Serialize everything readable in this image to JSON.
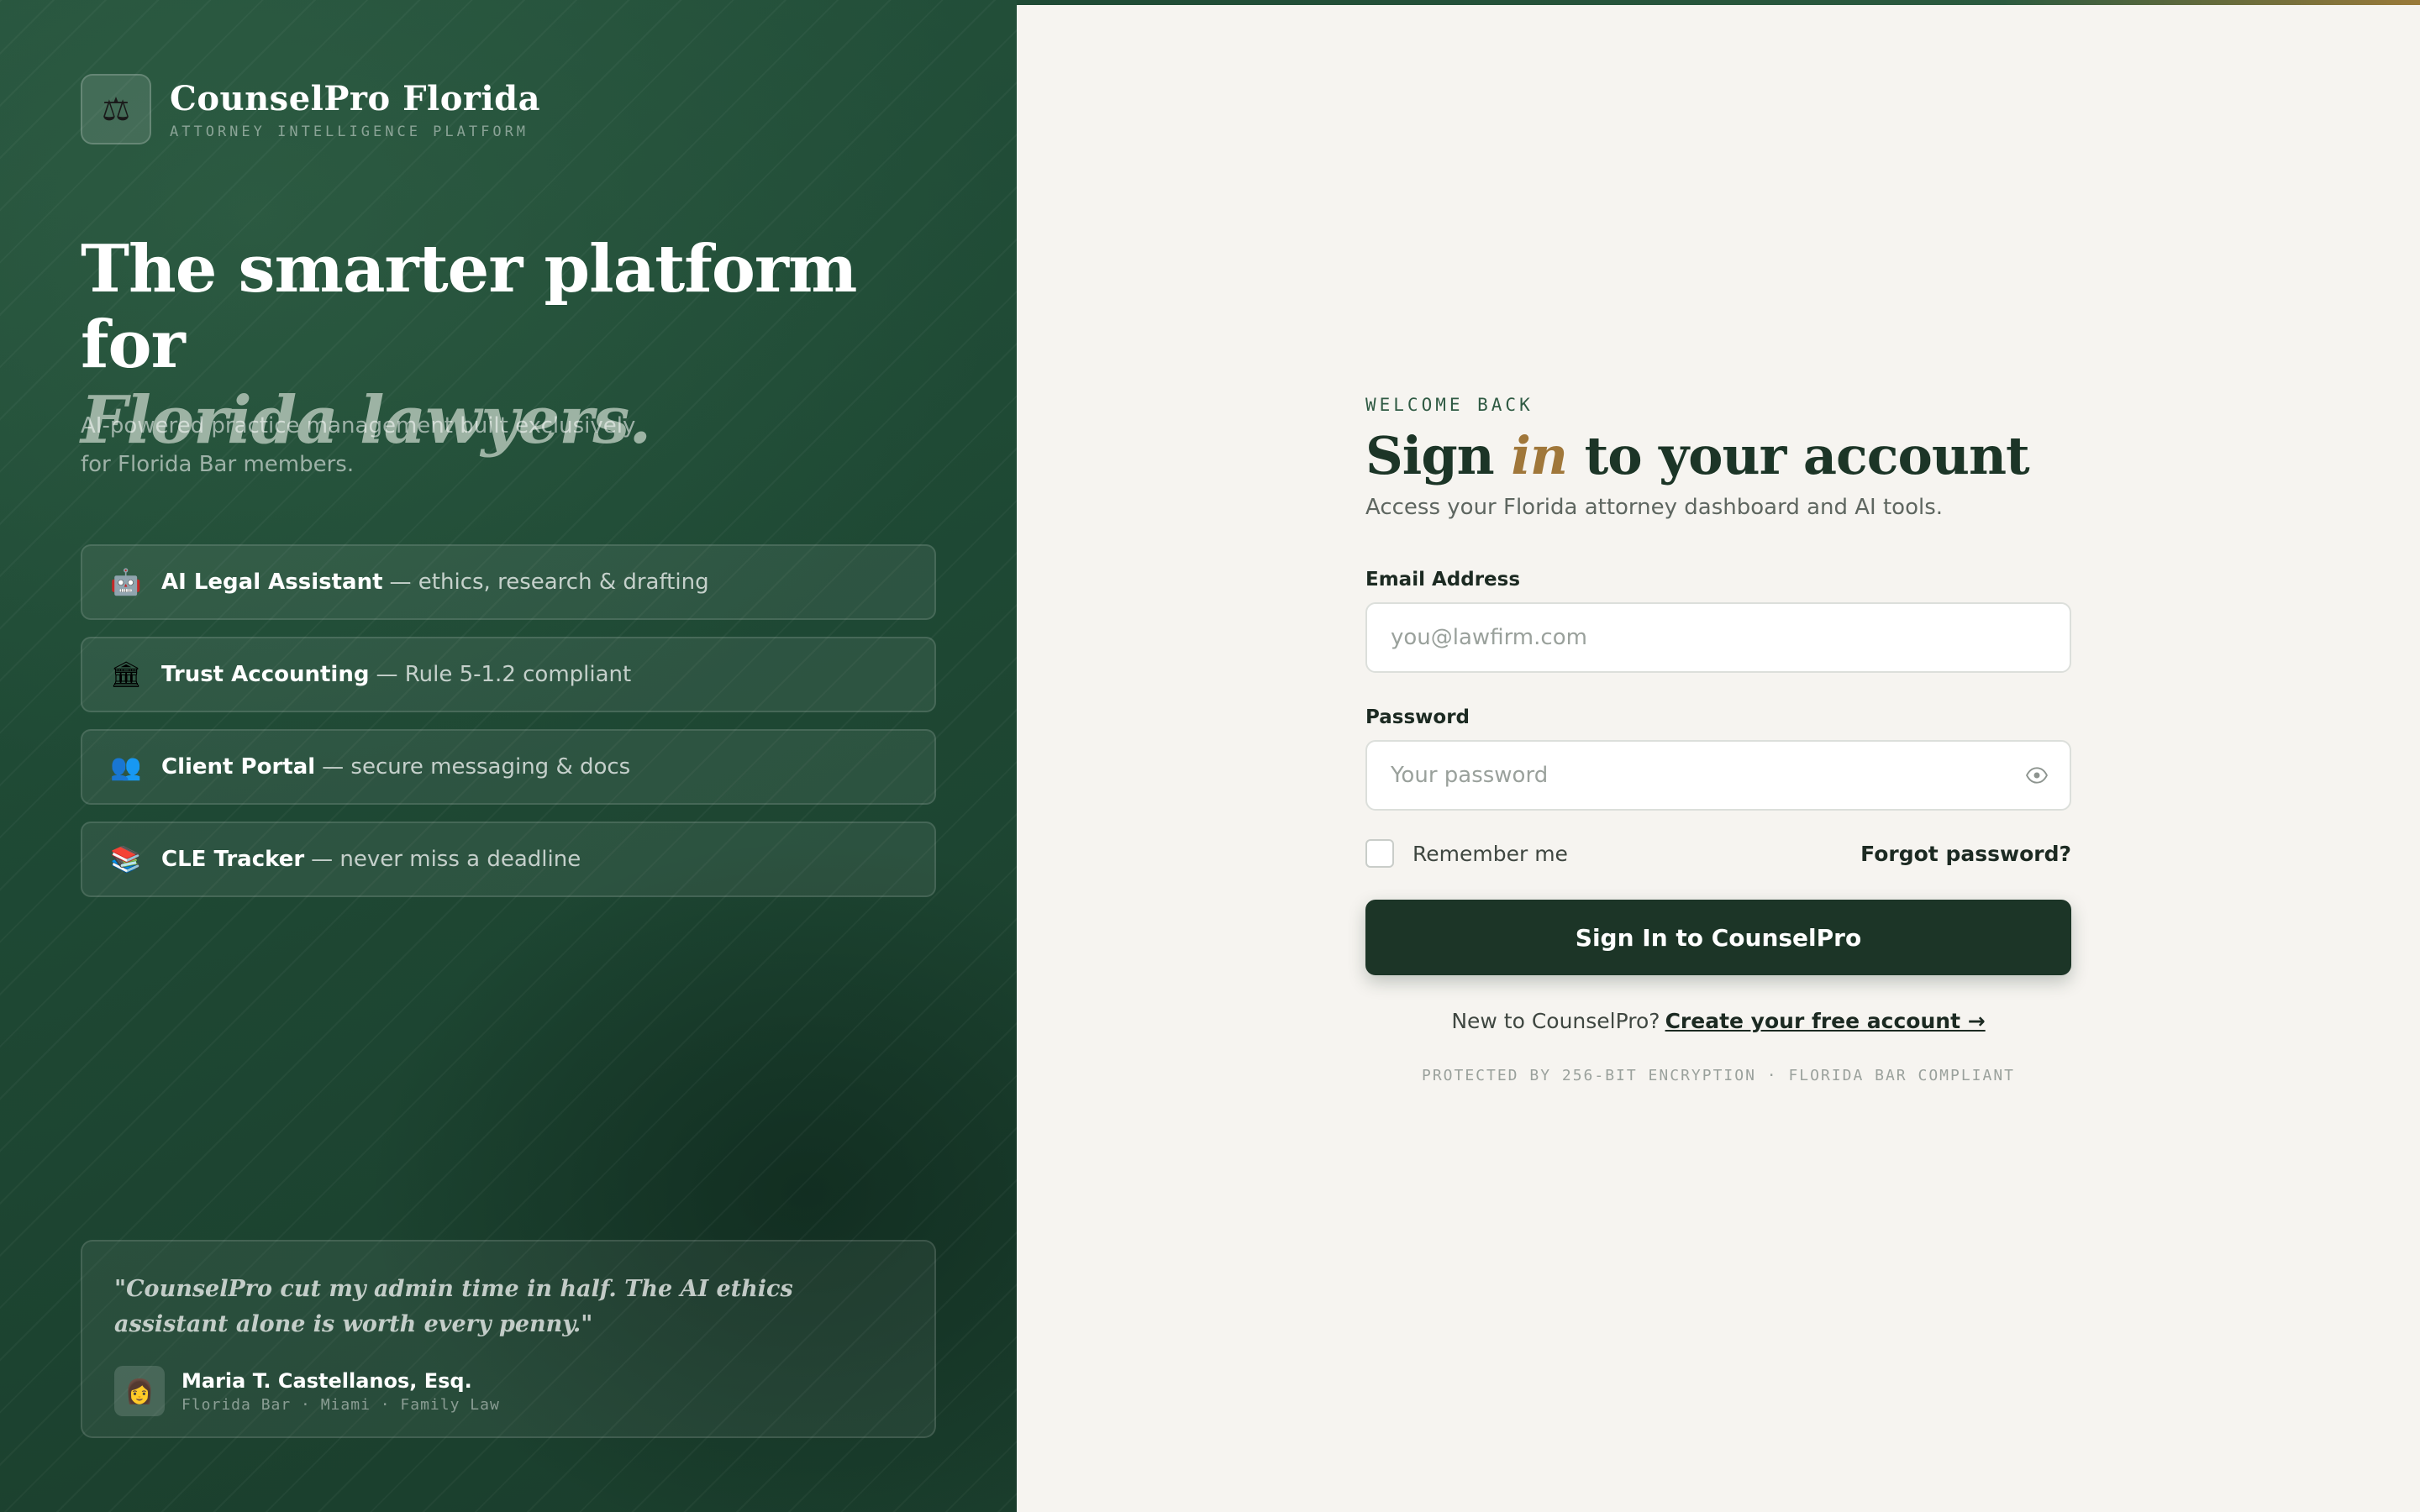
{
  "brand": {
    "icon": "⚖",
    "name": "CounselPro Florida",
    "tagline": "ATTORNEY INTELLIGENCE PLATFORM"
  },
  "hero": {
    "line1": "The smarter platform for",
    "line2": "Florida lawyers.",
    "subhead": "AI-powered practice management built exclusively for Florida Bar members."
  },
  "features": [
    {
      "icon": "🤖",
      "title": "AI Legal Assistant",
      "desc": "— ethics, research & drafting"
    },
    {
      "icon": "🏛",
      "title": "Trust Accounting",
      "desc": "— Rule 5-1.2 compliant"
    },
    {
      "icon": "👥",
      "title": "Client Portal",
      "desc": "— secure messaging & docs"
    },
    {
      "icon": "📚",
      "title": "CLE Tracker",
      "desc": "— never miss a deadline"
    }
  ],
  "testimonial": {
    "quote": "\"CounselPro cut my admin time in half. The AI ethics assistant alone is worth every penny.\"",
    "avatar": "👩",
    "name": "Maria T. Castellanos, Esq.",
    "meta": "Florida Bar · Miami · Family Law"
  },
  "login": {
    "eyebrow": "WELCOME BACK",
    "title_pre": "Sign ",
    "title_accent": "in",
    "title_post": " to your account",
    "subtitle": "Access your Florida attorney dashboard and AI tools.",
    "email_label": "Email Address",
    "email_value": "",
    "email_placeholder": "you@lawfirm.com",
    "password_label": "Password",
    "password_value": "",
    "password_placeholder": "Your password",
    "remember_label": "Remember me",
    "forgot_label": "Forgot password?",
    "submit_label": "Sign In to CounselPro",
    "signup_prompt": "New to CounselPro?",
    "signup_link": "Create your free account →",
    "footer_note": "PROTECTED BY 256-BIT ENCRYPTION · FLORIDA BAR COMPLIANT"
  },
  "colors": {
    "panel_green": "#1f4a35",
    "button_dark": "#1c3527",
    "gold_accent": "#a0773a"
  }
}
